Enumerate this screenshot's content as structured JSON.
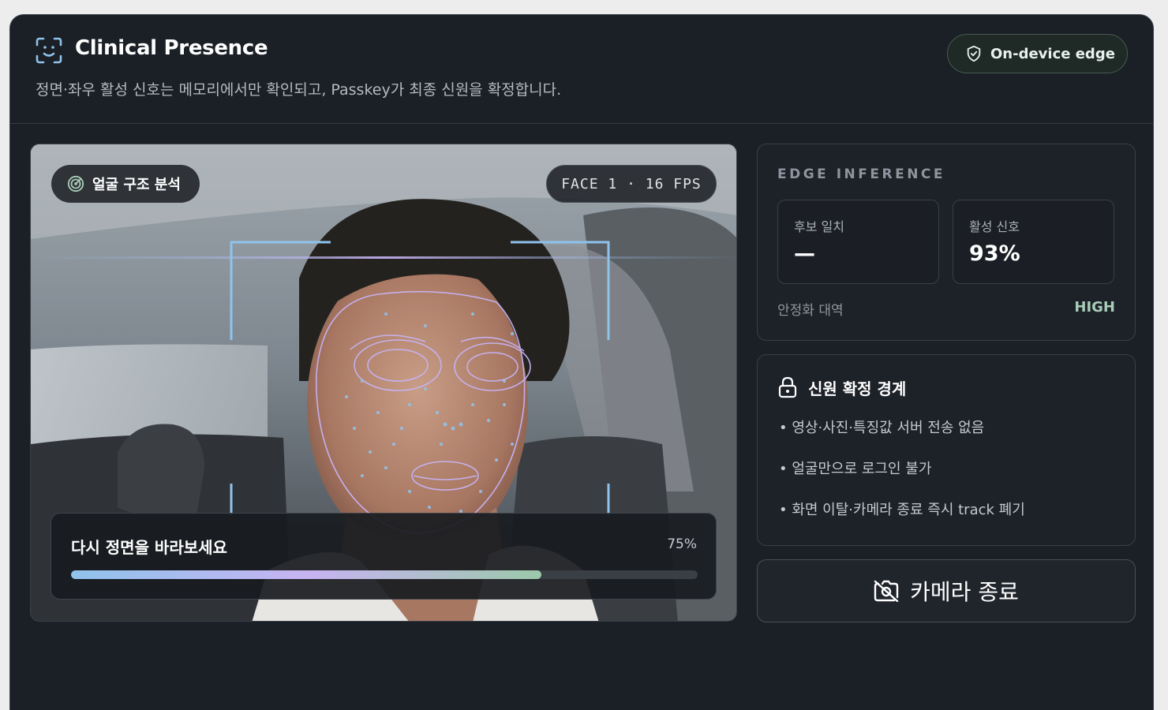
{
  "header": {
    "title": "Clinical Presence",
    "subtitle": "정면·좌우 활성 신호는 메모리에서만 확인되고, Passkey가 최종 신원을 확정합니다.",
    "badge": "On-device edge",
    "title_icon": "face-scan-icon",
    "badge_icon": "shield-check-icon"
  },
  "camera": {
    "analysis_label": "얼굴 구조 분석",
    "analysis_icon": "radar-icon",
    "stream_info": "FACE 1 · 16 FPS",
    "prompt": "다시 정면을 바라보세요",
    "progress_text": "75%",
    "progress": 0.75
  },
  "inference": {
    "title": "EDGE INFERENCE",
    "candidate_label": "후보 일치",
    "candidate_value": "—",
    "liveness_label": "활성 신호",
    "liveness_value": "93%",
    "stability_label": "안정화 대역",
    "stability_value": "HIGH"
  },
  "trust": {
    "title": "신원 확정 경계",
    "icon": "lock-icon",
    "rules": [
      "영상·사진·특징값 서버 전송 없음",
      "얼굴만으로 로그인 불가",
      "화면 이탈·카메라 종료 즉시 track 폐기"
    ]
  },
  "actions": {
    "stop_camera": "카메라 종료",
    "stop_icon": "camera-off-icon"
  },
  "colors": {
    "background": "#1b1f26",
    "accent_blue": "#8fc3ec",
    "accent_purple": "#c7b3f2",
    "accent_green": "#9cc9aa",
    "high_status": "#a9cdb7"
  }
}
